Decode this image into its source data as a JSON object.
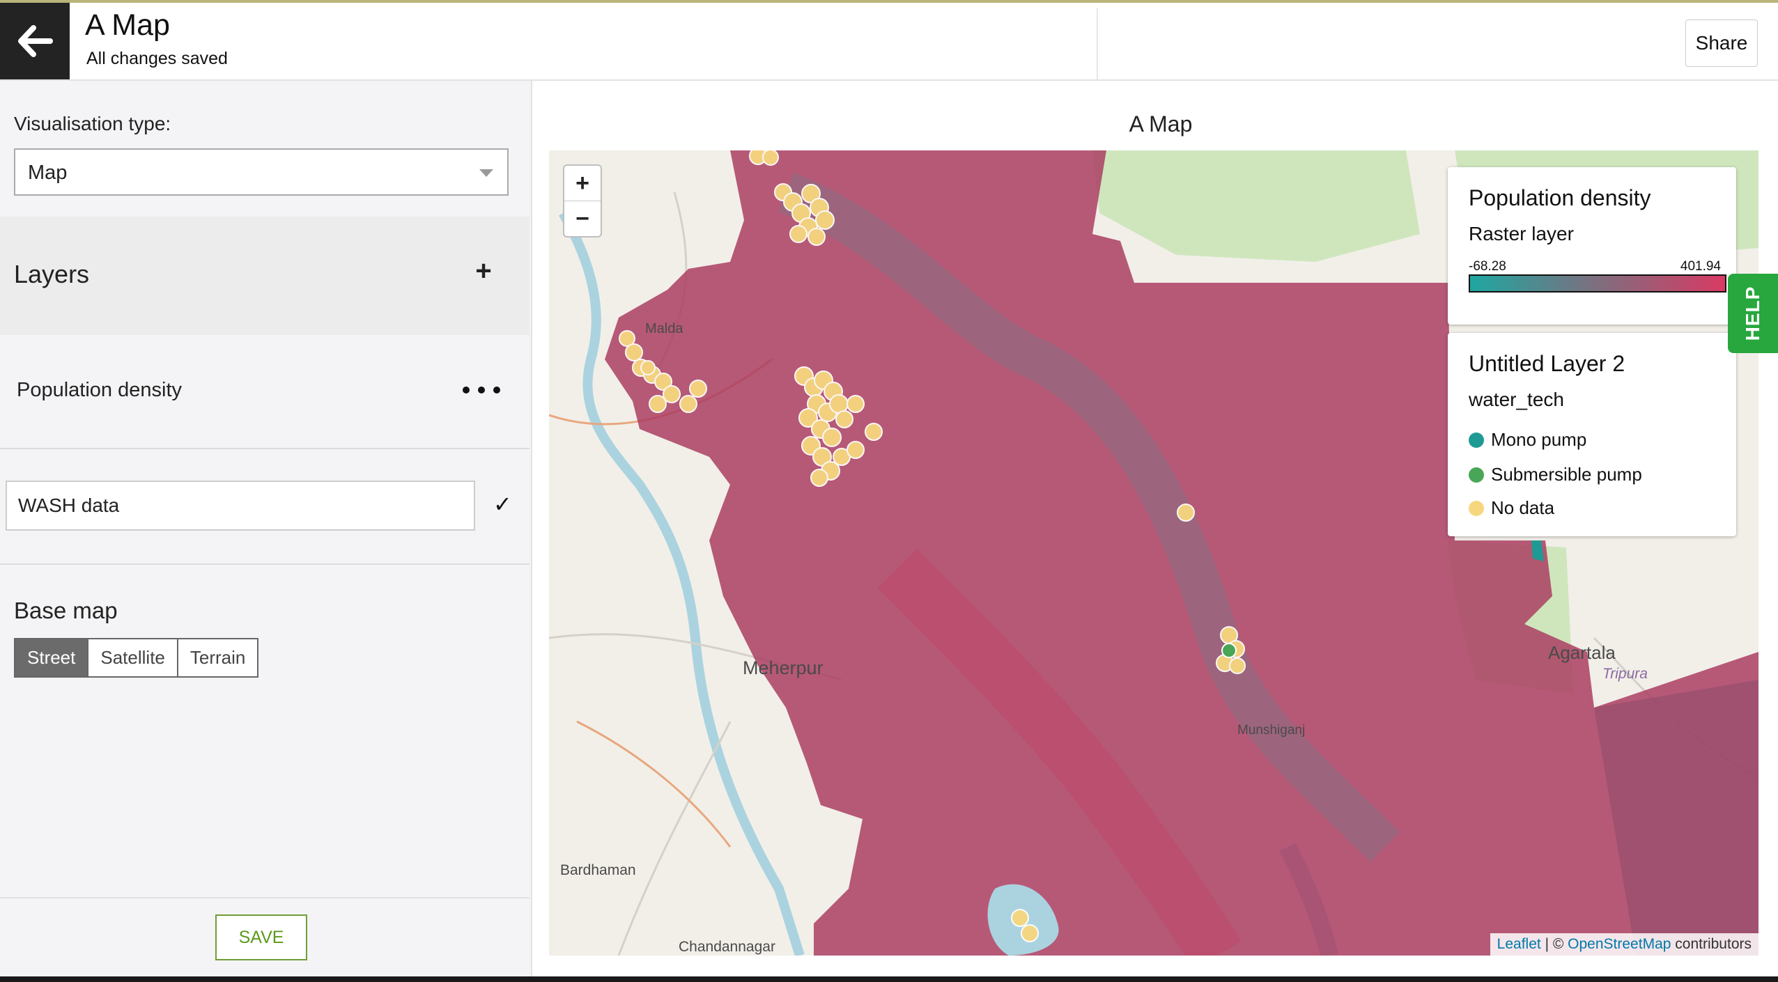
{
  "header": {
    "title": "A Map",
    "status": "All changes saved",
    "share_label": "Share"
  },
  "sidebar": {
    "visualisation_label": "Visualisation type:",
    "visualisation_value": "Map",
    "layers_title": "Layers",
    "layers": [
      {
        "name": "Population density"
      },
      {
        "name": "WASH data"
      }
    ],
    "base_map_title": "Base map",
    "base_map_options": [
      "Street",
      "Satellite",
      "Terrain"
    ],
    "base_map_selected": "Street",
    "save_label": "SAVE"
  },
  "map": {
    "title": "A Map",
    "labels": [
      "Malda",
      "Meherpur",
      "Bardhaman",
      "Chandannagar",
      "Agartala",
      "Tripura",
      "Munshiganj"
    ],
    "attribution": {
      "leaflet": "Leaflet",
      "separator": " | © ",
      "osm": "OpenStreetMap",
      "suffix": " contributors"
    }
  },
  "legend": {
    "raster": {
      "title": "Population density",
      "subtitle": "Raster layer",
      "min": "-68.28",
      "max": "401.94",
      "ramp_colors": [
        "#1ea7a1",
        "#7e6e7e",
        "#d93a64"
      ]
    },
    "points": {
      "title": "Untitled Layer 2",
      "subtitle": "water_tech",
      "items": [
        {
          "label": "Mono pump",
          "color": "#1e9a94"
        },
        {
          "label": "Submersible pump",
          "color": "#4aa657"
        },
        {
          "label": "No data",
          "color": "#f6d77e"
        }
      ]
    }
  },
  "help_label": "HELP",
  "colors": {
    "accent_green": "#27a73d",
    "save_green": "#5a9a1d",
    "raster_overlay": "#a8385e"
  }
}
